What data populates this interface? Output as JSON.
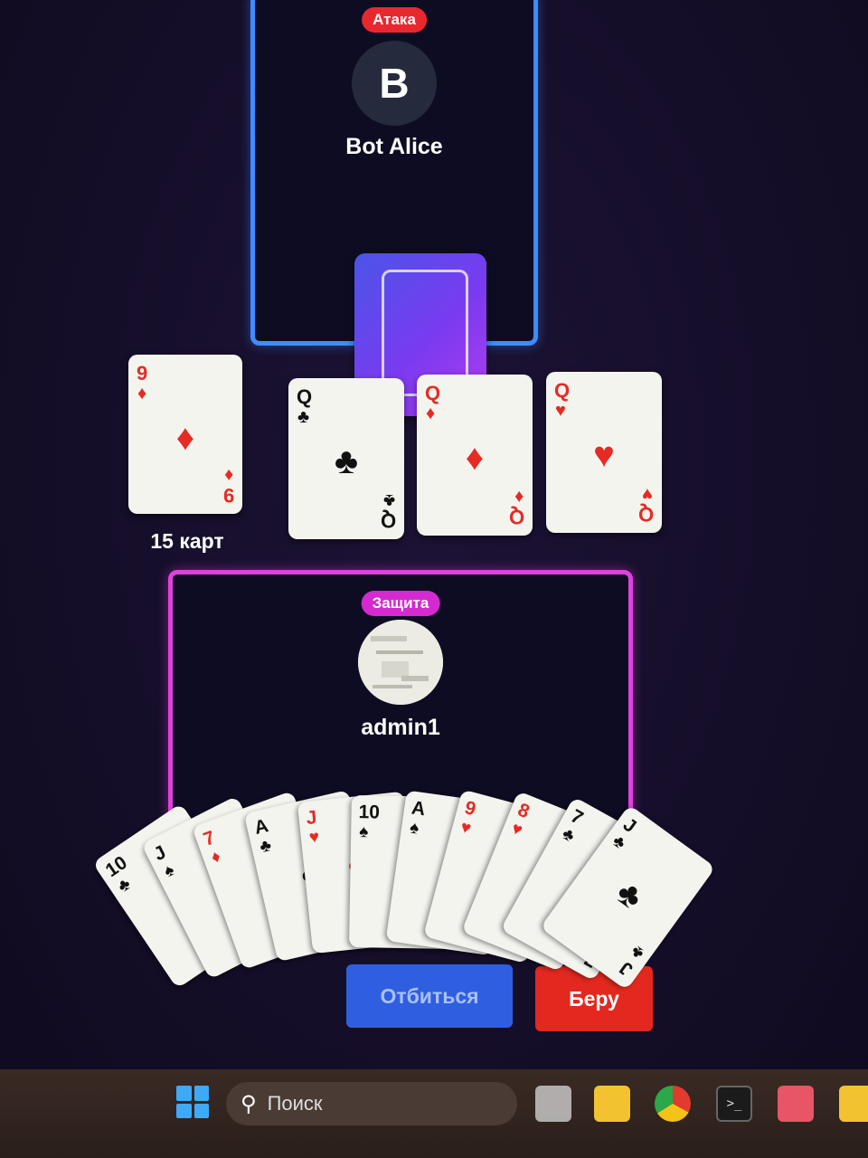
{
  "opponent": {
    "role_badge": "Атака",
    "avatar_letter": "B",
    "name": "Bot Alice"
  },
  "player": {
    "role_badge": "Защита",
    "name": "admin1"
  },
  "deck": {
    "count_label": "15 карт"
  },
  "trump_card": {
    "rank": "9",
    "suit": "♦",
    "color": "red"
  },
  "table_cards": [
    {
      "rank": "Q",
      "suit": "♣",
      "color": "black"
    },
    {
      "rank": "Q",
      "suit": "♦",
      "color": "red"
    },
    {
      "rank": "Q",
      "suit": "♥",
      "color": "red"
    }
  ],
  "hand": [
    {
      "rank": "10",
      "suit": "♣",
      "color": "black"
    },
    {
      "rank": "J",
      "suit": "♠",
      "color": "black"
    },
    {
      "rank": "7",
      "suit": "♦",
      "color": "red"
    },
    {
      "rank": "A",
      "suit": "♣",
      "color": "black"
    },
    {
      "rank": "J",
      "suit": "♥",
      "color": "red"
    },
    {
      "rank": "10",
      "suit": "♠",
      "color": "black"
    },
    {
      "rank": "A",
      "suit": "♠",
      "color": "black"
    },
    {
      "rank": "9",
      "suit": "♥",
      "color": "red"
    },
    {
      "rank": "8",
      "suit": "♥",
      "color": "red"
    },
    {
      "rank": "7",
      "suit": "♣",
      "color": "black"
    },
    {
      "rank": "J",
      "suit": "♣",
      "color": "black"
    }
  ],
  "buttons": {
    "defend": "Отбиться",
    "take": "Беру"
  },
  "taskbar": {
    "search_placeholder": "Поиск",
    "icons": [
      "windows-start-icon",
      "search-icon",
      "task-view-icon",
      "file-explorer-icon",
      "chrome-icon",
      "terminal-icon",
      "telegram-icon",
      "app-icon"
    ]
  },
  "colors": {
    "attack": "#3f8cff",
    "defense": "#e23fe0",
    "take_button": "#e3281f",
    "defend_button": "#2f5fe0"
  }
}
